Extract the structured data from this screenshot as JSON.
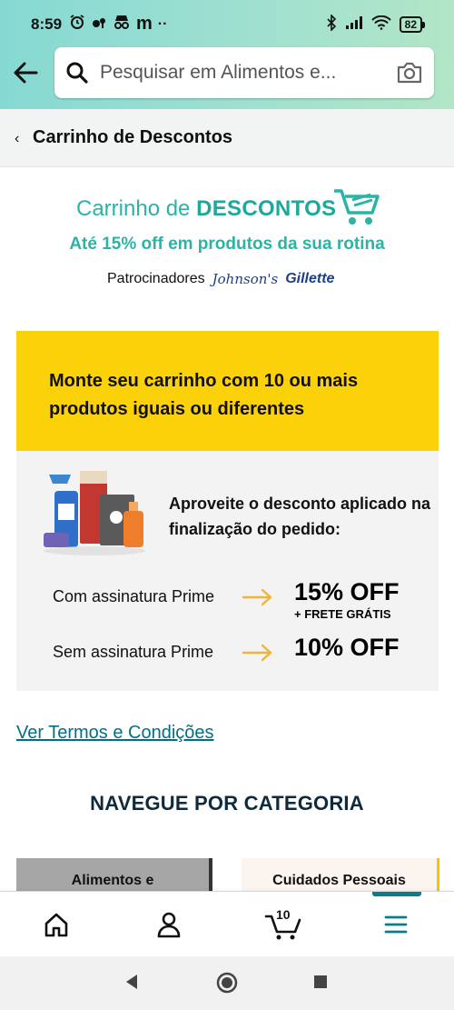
{
  "status_bar": {
    "time": "8:59",
    "left_icons": [
      "alarm-icon",
      "bluetooth-earbuds-icon",
      "incognito-icon",
      "gmail-icon",
      "more-icon"
    ],
    "gmail_glyph": "m",
    "more_glyph": "··",
    "battery": "82"
  },
  "search": {
    "placeholder": "Pesquisar em Alimentos e..."
  },
  "breadcrumb": {
    "back_glyph": "‹",
    "title": "Carrinho de Descontos"
  },
  "hero": {
    "title_light": "Carrinho de ",
    "title_bold": "DESCONTOS",
    "subtitle": "Até 15% off em produtos da sua rotina",
    "sponsors_label": "Patrocinadores",
    "sponsor1": "Johnson's",
    "sponsor2": "Gillette"
  },
  "banner": {
    "text": "Monte seu carrinho com 10 ou mais produtos iguais ou diferentes"
  },
  "panel": {
    "intro": "Aproveite o desconto aplicado na finalização do pedido:",
    "rows": [
      {
        "label": "Com assinatura Prime",
        "value": "15% OFF",
        "extra": "+ FRETE GRÁTIS"
      },
      {
        "label": "Sem assinatura Prime",
        "value": "10% OFF"
      }
    ]
  },
  "terms_link": "Ver Termos e Condições",
  "category": {
    "title": "NAVEGUE POR CATEGORIA",
    "tiles": [
      "Alimentos e",
      "Cuidados Pessoais"
    ]
  },
  "bottom_nav": {
    "cart_count": "10"
  },
  "colors": {
    "teal": "#2bb3a6",
    "yellow": "#fbd20a",
    "link": "#007185",
    "orange_arrow": "#f0b43a"
  }
}
